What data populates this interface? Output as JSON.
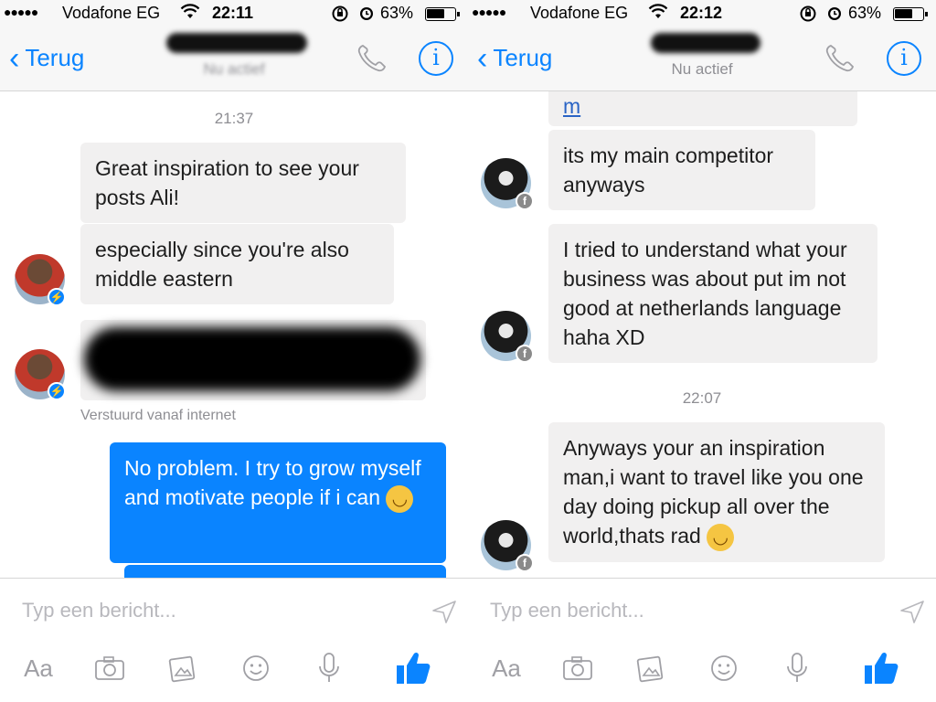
{
  "left": {
    "status": {
      "carrier": "Vodafone EG",
      "time": "22:11",
      "battery": "63%",
      "battery_fraction": 0.63
    },
    "header": {
      "back_label": "Terug",
      "contact_status": "Nu actief"
    },
    "messages": {
      "timestamp": "21:37",
      "received_1": "Great inspiration to see your posts Ali!",
      "received_2": "especially since you're also middle eastern",
      "sent_note": "Verstuurd vanaf internet",
      "sent_1": "No problem. I try to grow myself and motivate people if i can"
    },
    "composer": {
      "placeholder": "Typ een bericht...",
      "aa_label": "Aa"
    }
  },
  "right": {
    "status": {
      "carrier": "Vodafone EG",
      "time": "22:12",
      "battery": "63%",
      "battery_fraction": 0.63
    },
    "header": {
      "back_label": "Terug",
      "contact_status": "Nu actief"
    },
    "messages": {
      "link_fragment": "m",
      "received_1": "its my main competitor anyways",
      "received_2": "I tried to understand what your business was about put im not good at netherlands language haha XD",
      "timestamp": "22:07",
      "received_3": "Anyways your an inspiration man,i want to travel like you one day doing pickup all over the world,thats rad"
    },
    "composer": {
      "placeholder": "Typ een bericht...",
      "aa_label": "Aa"
    }
  },
  "colors": {
    "accent": "#0a84ff",
    "bubble_received": "#f1f0f0",
    "bubble_sent": "#0a84ff",
    "muted": "#8e8e93"
  },
  "icons": [
    "wifi-icon",
    "orientation-lock-icon",
    "alarm-icon",
    "battery-icon",
    "back-chevron-icon",
    "phone-icon",
    "info-icon",
    "messenger-badge-icon",
    "facebook-badge-icon",
    "send-icon",
    "camera-icon",
    "gallery-icon",
    "emoji-icon",
    "microphone-icon",
    "like-icon"
  ]
}
